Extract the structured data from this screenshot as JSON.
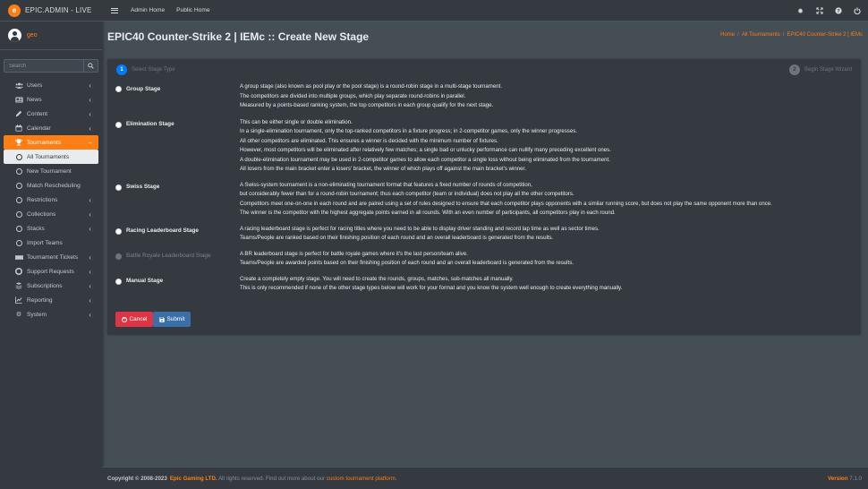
{
  "brand": {
    "logo_letter": "e",
    "title": "EPIC.ADMIN - LIVE"
  },
  "user": {
    "name": "geo"
  },
  "sidebar": {
    "search_placeholder": "Search",
    "items": [
      {
        "label": "Users",
        "icon": "users-icon"
      },
      {
        "label": "News",
        "icon": "newspaper-icon"
      },
      {
        "label": "Content",
        "icon": "pencil-icon"
      },
      {
        "label": "Calendar",
        "icon": "calendar-icon"
      },
      {
        "label": "Tournaments",
        "icon": "trophy-icon"
      },
      {
        "label": "All Tournaments"
      },
      {
        "label": "New Tournament"
      },
      {
        "label": "Match Rescheduling"
      },
      {
        "label": "Restrictions"
      },
      {
        "label": "Collections"
      },
      {
        "label": "Stacks"
      },
      {
        "label": "Import Teams"
      },
      {
        "label": "Tournament Tickets",
        "icon": "ticket-icon"
      },
      {
        "label": "Support Requests",
        "icon": "support-icon"
      },
      {
        "label": "Subscriptions",
        "icon": "subscriptions-icon"
      },
      {
        "label": "Reporting",
        "icon": "chart-line-icon"
      },
      {
        "label": "System",
        "icon": "cog-icon"
      }
    ]
  },
  "topbar": {
    "links": [
      "Admin Home",
      "Public Home"
    ],
    "icons": [
      "settings-icon",
      "expand-icon",
      "help-icon",
      "power-icon"
    ]
  },
  "page": {
    "title": "EPIC40 Counter-Strike 2 | IEMc :: Create New Stage",
    "breadcrumb": [
      "Home",
      "All Tournaments",
      "EPIC40 Counter-Strike 2 | IEMc"
    ]
  },
  "wizard": {
    "step1": {
      "num": "1",
      "label": "Select Stage Type"
    },
    "step2": {
      "num": "2",
      "label": "Begin Stage Wizard"
    }
  },
  "options": [
    {
      "label": "Group Stage",
      "lines": [
        "A group stage (also known as pool play or the pool stage) is a round-robin stage in a multi-stage tournament.",
        "The competitors are divided into multiple groups, which play separate round-robins in parallel.",
        "Measured by a points-based ranking system, the top competitors in each group qualify for the next stage."
      ]
    },
    {
      "label": "Elimination Stage",
      "lines": [
        "This can be either single or double elimination.",
        "In a single-elimination tournament, only the top-ranked competitors in a fixture progress; in 2-competitor games, only the winner progresses.",
        "All other competitors are eliminated. This ensures a winner is decided with the minimum number of fixtures.",
        "However, most competitors will be eliminated after relatively few matches; a single bad or unlucky performance can nullify many preceding excellent ones.",
        "A double-elimination tournament may be used in 2-competitor games to allow each competitor a single loss without being eliminated from the tournament.",
        "All losers from the main bracket enter a losers' bracket, the winner of which plays off against the main bracket's winner."
      ]
    },
    {
      "label": "Swiss Stage",
      "lines": [
        "A Swiss-system tournament is a non-eliminating tournament format that features a fixed number of rounds of competition,",
        "but considerably fewer than for a round-robin tournament; thus each competitor (team or individual) does not play all the other competitors.",
        "Competitors meet one-on-one in each round and are paired using a set of rules designed to ensure that each competitor plays opponents with a similar running score, but does not play the same opponent more than once.",
        "The winner is the competitor with the highest aggregate points earned in all rounds. With an even number of participants, all competitors play in each round."
      ]
    },
    {
      "label": "Racing Leaderboard Stage",
      "lines": [
        "A racing leaderboard stage is perfect for racing titles where you need to be able to display driver standing and record lap time as well as sector times.",
        "Teams/People are ranked based on their finishing position of each round and an overall leaderboard is generated from the results."
      ]
    },
    {
      "label": "Battle Royale Leaderboard Stage",
      "disabled": true,
      "lines": [
        "A BR leaderboard stage is perfect for battle royale games where it's the last person/team alive.",
        "Teams/People are awarded points based on their finishing position of each round and an overall leaderboard is generated from the results."
      ]
    },
    {
      "label": "Manual Stage",
      "lines": [
        "Create a completely empty stage. You will need to create the rounds, groups, matches, sub-matches all manually.",
        "This is only recommended if none of the other stage types below will work for your format and you know the system well enough to create everything manually."
      ]
    }
  ],
  "buttons": {
    "cancel": "Cancel",
    "submit": "Submit"
  },
  "footer": {
    "copyright": "Copyright © 2008-2023",
    "company": "Epic Gaming LTD.",
    "text": " All rights reserved. Find out more about our ",
    "link": "custom tournament platform",
    "end": ".",
    "version_label": "Version",
    "version": "7.1.0"
  },
  "colors": {
    "accent": "#fd7e14",
    "primary": "#007bff",
    "danger": "#dc3545",
    "sidebar": "#343a40",
    "content": "#454d55"
  }
}
